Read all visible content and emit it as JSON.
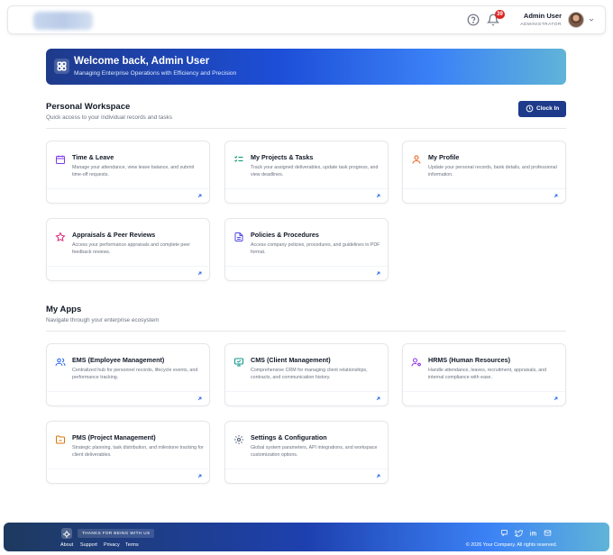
{
  "header": {
    "user_name": "Admin User",
    "user_role": "ADMINISTRATOR",
    "notification_count": "39",
    "icons": [
      "help-circle-icon",
      "bell-icon",
      "chevron-down-icon"
    ]
  },
  "hero": {
    "title": "Welcome back, Admin User",
    "subtitle": "Managing Enterprise Operations with Efficiency and Precision"
  },
  "workspace": {
    "title": "Personal Workspace",
    "subtitle": "Quick access to your individual records and tasks",
    "clock_in_label": "Clock In",
    "cards": [
      {
        "title": "Time & Leave",
        "desc": "Manage your attendance, view leave balance, and submit time-off requests.",
        "icon": "calendar-icon",
        "color": "#7c3aed"
      },
      {
        "title": "My Projects & Tasks",
        "desc": "Track your assigned deliverables, update task progress, and view deadlines.",
        "icon": "checklist-icon",
        "color": "#059669"
      },
      {
        "title": "My Profile",
        "desc": "Update your personal records, bank details, and professional information.",
        "icon": "user-icon",
        "color": "#ea580c"
      },
      {
        "title": "Appraisals & Peer Reviews",
        "desc": "Access your performance appraisals and complete peer feedback reviews.",
        "icon": "star-icon",
        "color": "#db2777"
      },
      {
        "title": "Policies & Procedures",
        "desc": "Access company policies, procedures, and guidelines in PDF format.",
        "icon": "document-icon",
        "color": "#4f46e5"
      }
    ]
  },
  "apps": {
    "title": "My Apps",
    "subtitle": "Navigate through your enterprise ecosystem",
    "cards": [
      {
        "title": "EMS (Employee Management)",
        "desc": "Centralized hub for personnel records, lifecycle events, and performance tracking.",
        "icon": "users-icon",
        "color": "#2563eb"
      },
      {
        "title": "CMS (Client Management)",
        "desc": "Comprehensive CRM for managing client relationships, contracts, and communication history.",
        "icon": "monitor-icon",
        "color": "#0d9488"
      },
      {
        "title": "HRMS (Human Resources)",
        "desc": "Handle attendance, leaves, recruitment, appraisals, and internal compliance with ease.",
        "icon": "user-cog-icon",
        "color": "#9333ea"
      },
      {
        "title": "PMS (Project Management)",
        "desc": "Strategic planning, task distribution, and milestone tracking for client deliverables.",
        "icon": "folder-icon",
        "color": "#d97706"
      },
      {
        "title": "Settings & Configuration",
        "desc": "Global system parameters, API integrations, and workspace customization options.",
        "icon": "gear-icon",
        "color": "#475569"
      }
    ]
  },
  "footer": {
    "tagline": "THANKS FOR BEING WITH US",
    "links": [
      "About",
      "Support",
      "Privacy",
      "Terms"
    ],
    "copyright": "© 2026 Your Company. All rights reserved.",
    "social_icons": [
      "chat-icon",
      "twitter-icon",
      "linkedin-icon",
      "mail-icon"
    ]
  }
}
